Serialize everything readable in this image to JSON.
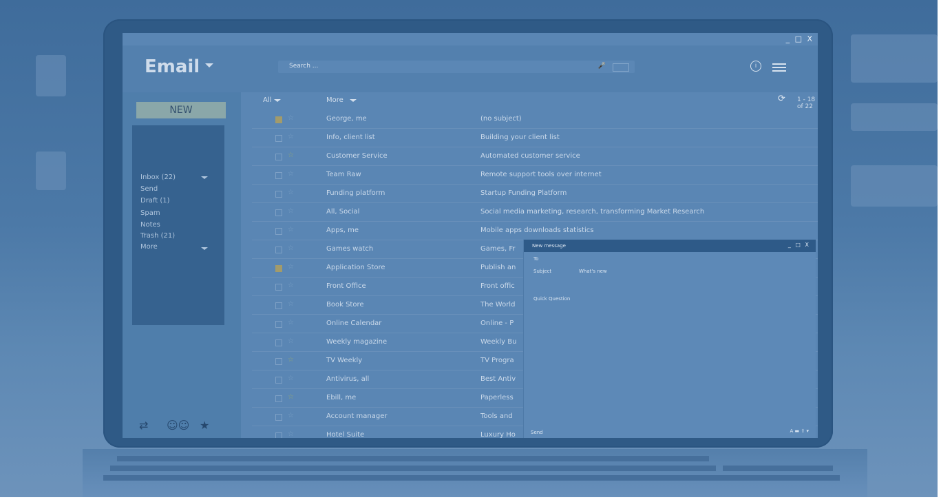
{
  "window": {
    "controls": "_ □ X"
  },
  "header": {
    "brand": "Email",
    "search_placeholder": "Search ..."
  },
  "sidebar": {
    "new_button": "NEW",
    "folders": [
      {
        "label": "Inbox (22)",
        "has_caret": true
      },
      {
        "label": "Send"
      },
      {
        "label": "Draft (1)"
      },
      {
        "label": "Spam"
      },
      {
        "label": "Notes"
      },
      {
        "label": "Trash (21)"
      },
      {
        "label": "More",
        "has_caret": true
      }
    ],
    "bottom_icons": [
      "swap-icon",
      "contacts-icon",
      "star-icon"
    ]
  },
  "toolbar": {
    "all_label": "All",
    "more_label": "More",
    "page_count": "1 - 18 of 22",
    "prev_label": "◀",
    "next_label": "▶"
  },
  "emails": [
    {
      "sender": "George, me",
      "subject": "(no subject)",
      "checked": true,
      "starred": false
    },
    {
      "sender": "Info, client list",
      "subject": "Building your client list",
      "checked": false,
      "starred": false
    },
    {
      "sender": "Customer Service",
      "subject": "Automated customer service",
      "checked": false,
      "starred": true
    },
    {
      "sender": "Team Raw",
      "subject": "Remote support tools over internet",
      "checked": false,
      "starred": false
    },
    {
      "sender": "Funding platform",
      "subject": "Startup Funding Platform",
      "checked": false,
      "starred": false
    },
    {
      "sender": "All, Social",
      "subject": "Social media marketing, research, transforming Market Research",
      "checked": false,
      "starred": false
    },
    {
      "sender": "Apps, me",
      "subject": "Mobile apps downloads statistics",
      "checked": false,
      "starred": false
    },
    {
      "sender": "Games watch",
      "subject": "Games, Fr",
      "checked": false,
      "starred": false
    },
    {
      "sender": "Application Store",
      "subject": "Publish an",
      "checked": true,
      "starred": false
    },
    {
      "sender": "Front Office",
      "subject": "Front offic",
      "checked": false,
      "starred": false
    },
    {
      "sender": "Book Store",
      "subject": "The World",
      "checked": false,
      "starred": false
    },
    {
      "sender": "Online Calendar",
      "subject": "Online - P",
      "checked": false,
      "starred": false
    },
    {
      "sender": "Weekly magazine",
      "subject": "Weekly Bu",
      "checked": false,
      "starred": false
    },
    {
      "sender": "TV Weekly",
      "subject": "TV Progra",
      "checked": false,
      "starred": true
    },
    {
      "sender": "Antivirus, all",
      "subject": "Best Antiv",
      "checked": false,
      "starred": false
    },
    {
      "sender": "Ebill, me",
      "subject": "Paperless",
      "checked": false,
      "starred": true
    },
    {
      "sender": "Account manager",
      "subject": "Tools and",
      "checked": false,
      "starred": false
    },
    {
      "sender": "Hotel Suite",
      "subject": "Luxury Ho",
      "checked": false,
      "starred": false
    }
  ],
  "compose": {
    "title": "New message",
    "controls": "_ □ X",
    "to_label": "To",
    "subject_label": "Subject",
    "subject_value": "What's new",
    "body": "Quick Question",
    "send_label": "Send",
    "footer_tools": "A ▬ ⇧ ▾"
  },
  "colors": {
    "tint": "#4f7eab",
    "sidebar_panel": "#36628f",
    "compose_header": "#2e5a88",
    "new_button": "#8aa7a9"
  }
}
